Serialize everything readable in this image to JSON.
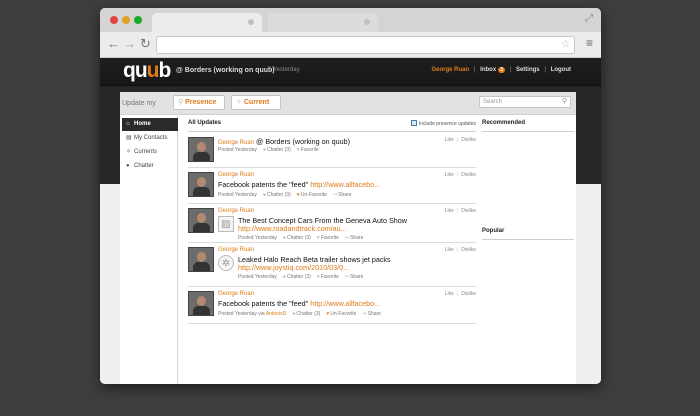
{
  "browser": {
    "star_icon": "star-icon",
    "menu_icon": "hamburger-icon"
  },
  "header": {
    "logo": "quub",
    "context_title": "@ Borders (working on quub)",
    "context_time": "Yesterday",
    "user": "George Ruan",
    "inbox_label": "Inbox",
    "inbox_count": "3",
    "settings": "Settings",
    "logout": "Logout"
  },
  "update_bar": {
    "label": "Update my",
    "presence": "Presence",
    "current": "Current",
    "search_placeholder": "Search"
  },
  "sidebar": {
    "items": [
      {
        "label": "Home",
        "icon": "home-icon",
        "active": true
      },
      {
        "label": "My Contacts",
        "icon": "contacts-icon",
        "active": false
      },
      {
        "label": "Currents",
        "icon": "currents-icon",
        "active": false
      },
      {
        "label": "Chatter",
        "icon": "chat-icon",
        "active": false
      }
    ]
  },
  "feed": {
    "title": "All Updates",
    "include_presence": "Include presence updates",
    "posts": [
      {
        "author": "George Ruan",
        "headline": "@ Borders (working on quub)",
        "link": "",
        "meta_posted": "Posted Yesterday",
        "chatter": "Chatter (3)",
        "favorite": "Favorite",
        "share": "",
        "like": "Like",
        "dislike": "Dislike"
      },
      {
        "author": "George Ruan",
        "headline": "Facebook patents the \"feed\" ",
        "link": "http://www.allfacebo...",
        "meta_posted": "Posted Yesterday",
        "chatter": "Chatter (3)",
        "favorite": "Un-Favorite",
        "share": "Share",
        "like": "Like",
        "dislike": "Dislike"
      },
      {
        "author": "George Ruan",
        "headline": "The Best Concept Cars From the Geneva Auto Show",
        "link": "http://www.roadandtrack.com/au...",
        "meta_posted": "Posted Yesterday",
        "chatter": "Chatter (3)",
        "favorite": "Favorite",
        "share": "Share",
        "like": "Like",
        "dislike": "Dislike"
      },
      {
        "author": "George Ruan",
        "headline": "Leaked Halo Reach Beta trailer shows jet packs",
        "link": "http://www.joystiq.com/2010/03/0...",
        "meta_posted": "Posted Yesterday",
        "chatter": "Chatter (3)",
        "favorite": "Favorite",
        "share": "Share",
        "like": "Like",
        "dislike": "Dislike"
      },
      {
        "author": "George Ruan",
        "headline": "Facebook patents the \"feed\" ",
        "link": "http://www.allfacebo...",
        "meta_posted": "Posted Yesterday via ",
        "via": "AntonioD",
        "chatter": "Chatter (3)",
        "favorite": "Un-Favorite",
        "share": "Share",
        "like": "Like",
        "dislike": "Dislike"
      }
    ]
  },
  "right_column": {
    "recommended": "Recommended",
    "popular": "Popular"
  },
  "colors": {
    "accent": "#e07b1a",
    "dark": "#272727"
  }
}
